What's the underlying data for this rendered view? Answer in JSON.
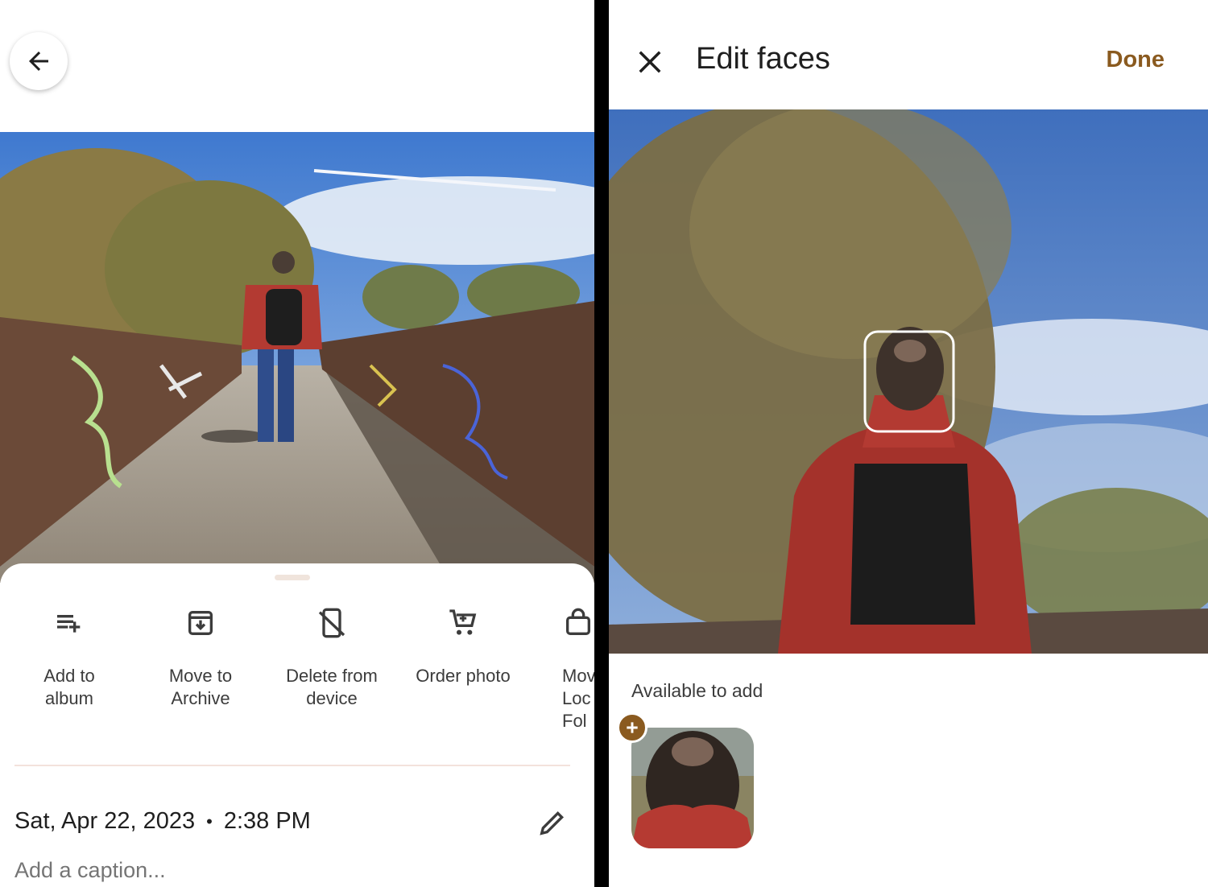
{
  "left_screen": {
    "back_icon": "arrow-left-icon",
    "actions": [
      {
        "label": "Add to\nalbum",
        "icon": "playlist-add-icon"
      },
      {
        "label": "Move to\nArchive",
        "icon": "archive-icon"
      },
      {
        "label": "Delete from\ndevice",
        "icon": "phone-delete-icon"
      },
      {
        "label": "Order photo",
        "icon": "cart-icon"
      },
      {
        "label": "Mov\nLoc\nFol",
        "icon": "folder-lock-icon"
      }
    ],
    "date": "Sat, Apr 22, 2023",
    "separator": "•",
    "time": "2:38 PM",
    "caption_placeholder": "Add a caption..."
  },
  "right_screen": {
    "close_icon": "close-icon",
    "title": "Edit faces",
    "done_label": "Done",
    "available_label": "Available to add",
    "add_icon": "plus-icon"
  },
  "colors": {
    "accent": "#8a5a1f",
    "divider": "#f3e2dc",
    "text_secondary": "#757575"
  }
}
